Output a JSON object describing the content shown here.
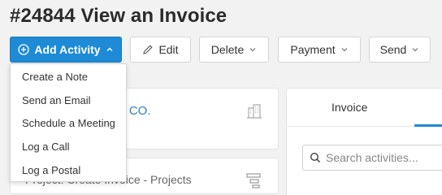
{
  "page": {
    "title": "#24844 View an Invoice"
  },
  "toolbar": {
    "add_activity_label": "Add Activity",
    "edit_label": "Edit",
    "delete_label": "Delete",
    "payment_label": "Payment",
    "send_label": "Send"
  },
  "activity_menu": {
    "items": [
      {
        "label": "Create a Note"
      },
      {
        "label": "Send an Email"
      },
      {
        "label": "Schedule a Meeting"
      },
      {
        "label": "Log a Call"
      },
      {
        "label": "Log a Postal"
      }
    ]
  },
  "company_card": {
    "company_name_visible": "O CO."
  },
  "project_card": {
    "project_text": "Project: Create Invoice - Projects"
  },
  "right_panel": {
    "tabs": [
      {
        "label": "Invoice"
      }
    ],
    "search": {
      "placeholder": "Search activities..."
    }
  },
  "colors": {
    "primary": "#1f8ad6",
    "link": "#2d7ec4",
    "background": "#f2f2f2"
  },
  "icons": [
    "plus-circle-icon",
    "chevron-up-icon",
    "pencil-icon",
    "chevron-down-icon",
    "building-icon",
    "hierarchy-icon",
    "search-icon"
  ]
}
